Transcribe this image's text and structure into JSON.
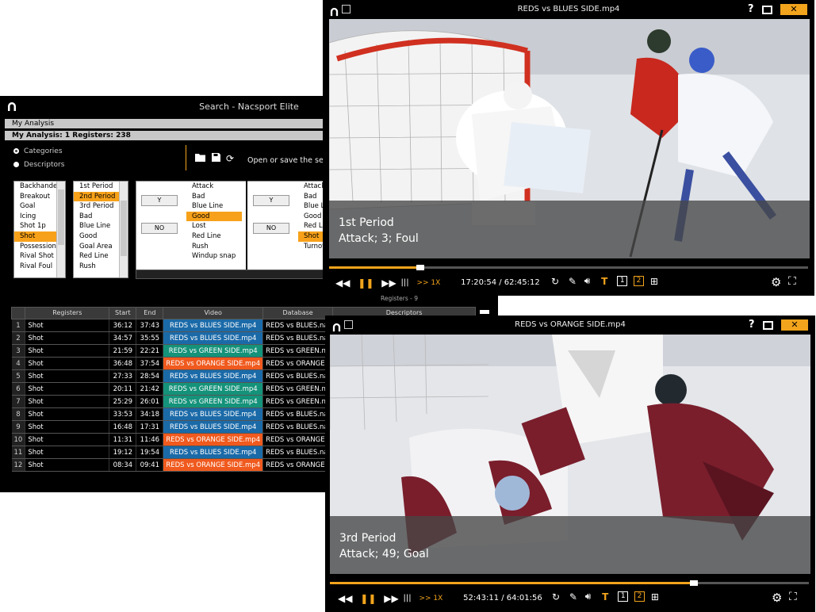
{
  "search_window": {
    "title": "Search - Nacsport Elite",
    "analysis_label": "My Analysis",
    "analysis_summary": "My Analysis: 1    Registers: 238",
    "radio_categories": "Categories",
    "radio_descriptors": "Descriptors",
    "hint": "Open or save the search",
    "registers_count": "Registers - 9",
    "list1": [
      "Backhander",
      "Breakout",
      "Goal",
      "Icing",
      "Shot 1p",
      "Shot",
      "Possession",
      "Rival Shot",
      "Rival Foul"
    ],
    "list1_selected": 5,
    "list2": [
      "1st Period",
      "2nd Period",
      "3rd Period",
      "Bad",
      "Blue Line",
      "Good",
      "Goal Area",
      "Red Line",
      "Rush"
    ],
    "list2_selected": 1,
    "list3": [
      "Attack",
      "Bad",
      "Blue Line",
      "Good",
      "Lost",
      "Red Line",
      "Rush",
      "Windup snap"
    ],
    "list3_selected": 3,
    "list4": [
      "Attack",
      "Bad",
      "Blue Line",
      "Good",
      "Red Line",
      "Shot",
      "Turnover"
    ],
    "list4_selected": 5,
    "yes_label": "Y",
    "no_label": "NO",
    "table": {
      "headers": [
        "",
        "Registers",
        "Start",
        "End",
        "Video",
        "Database",
        "Descriptors"
      ],
      "rows": [
        {
          "n": "1",
          "reg": "Shot",
          "start": "36:12",
          "end": "37:43",
          "video": "REDS vs BLUES SIDE.mp4",
          "db": "REDS vs BLUES.na",
          "color": "blue"
        },
        {
          "n": "2",
          "reg": "Shot",
          "start": "34:57",
          "end": "35:55",
          "video": "REDS vs BLUES SIDE.mp4",
          "db": "REDS vs BLUES.na",
          "color": "blue"
        },
        {
          "n": "3",
          "reg": "Shot",
          "start": "21:59",
          "end": "22:21",
          "video": "REDS vs GREEN SIDE.mp4",
          "db": "REDS vs GREEN.na",
          "color": "green"
        },
        {
          "n": "4",
          "reg": "Shot",
          "start": "36:48",
          "end": "37:54",
          "video": "REDS vs ORANGE SIDE.mp4",
          "db": "REDS vs ORANGE.",
          "color": "orange"
        },
        {
          "n": "5",
          "reg": "Shot",
          "start": "27:33",
          "end": "28:54",
          "video": "REDS vs BLUES SIDE.mp4",
          "db": "REDS vs BLUES.na",
          "color": "blue"
        },
        {
          "n": "6",
          "reg": "Shot",
          "start": "20:11",
          "end": "21:42",
          "video": "REDS vs GREEN SIDE.mp4",
          "db": "REDS vs GREEN.na",
          "color": "green"
        },
        {
          "n": "7",
          "reg": "Shot",
          "start": "25:29",
          "end": "26:01",
          "video": "REDS vs GREEN SIDE.mp4",
          "db": "REDS vs GREEN.na",
          "color": "green"
        },
        {
          "n": "8",
          "reg": "Shot",
          "start": "33:53",
          "end": "34:18",
          "video": "REDS vs BLUES SIDE.mp4",
          "db": "REDS vs BLUES.na",
          "color": "blue"
        },
        {
          "n": "9",
          "reg": "Shot",
          "start": "16:48",
          "end": "17:31",
          "video": "REDS vs BLUES SIDE.mp4",
          "db": "REDS vs BLUES.na",
          "color": "blue"
        },
        {
          "n": "10",
          "reg": "Shot",
          "start": "11:31",
          "end": "11:46",
          "video": "REDS vs ORANGE SIDE.mp4",
          "db": "REDS vs ORANGE.",
          "color": "orange"
        },
        {
          "n": "11",
          "reg": "Shot",
          "start": "19:12",
          "end": "19:54",
          "video": "REDS vs BLUES SIDE.mp4",
          "db": "REDS vs BLUES.na",
          "color": "blue"
        },
        {
          "n": "12",
          "reg": "Shot",
          "start": "08:34",
          "end": "09:41",
          "video": "REDS vs ORANGE SIDE.mp4",
          "db": "REDS vs ORANGE.",
          "color": "orange"
        }
      ]
    }
  },
  "player1": {
    "title": "REDS vs BLUES SIDE.mp4",
    "line1": "1st Period",
    "line2": "Attack; 3; Foul",
    "time": "17:20:54 / 62:45:12",
    "speed": ">> 1X",
    "progress": 0.19,
    "help": "?",
    "close": "✕",
    "t1": "1",
    "t2": "2"
  },
  "player2": {
    "title": "REDS vs ORANGE SIDE.mp4",
    "line1": "3rd Period",
    "line2": "Attack; 49; Goal",
    "time": "52:43:11 / 64:01:56",
    "speed": ">> 1X",
    "progress": 0.76,
    "help": "?",
    "close": "✕",
    "t1": "1",
    "t2": "2"
  },
  "colors": {
    "accent": "#f2a41c",
    "blue": "#1b6aa8",
    "green": "#14927a",
    "orange": "#f05a1e"
  }
}
